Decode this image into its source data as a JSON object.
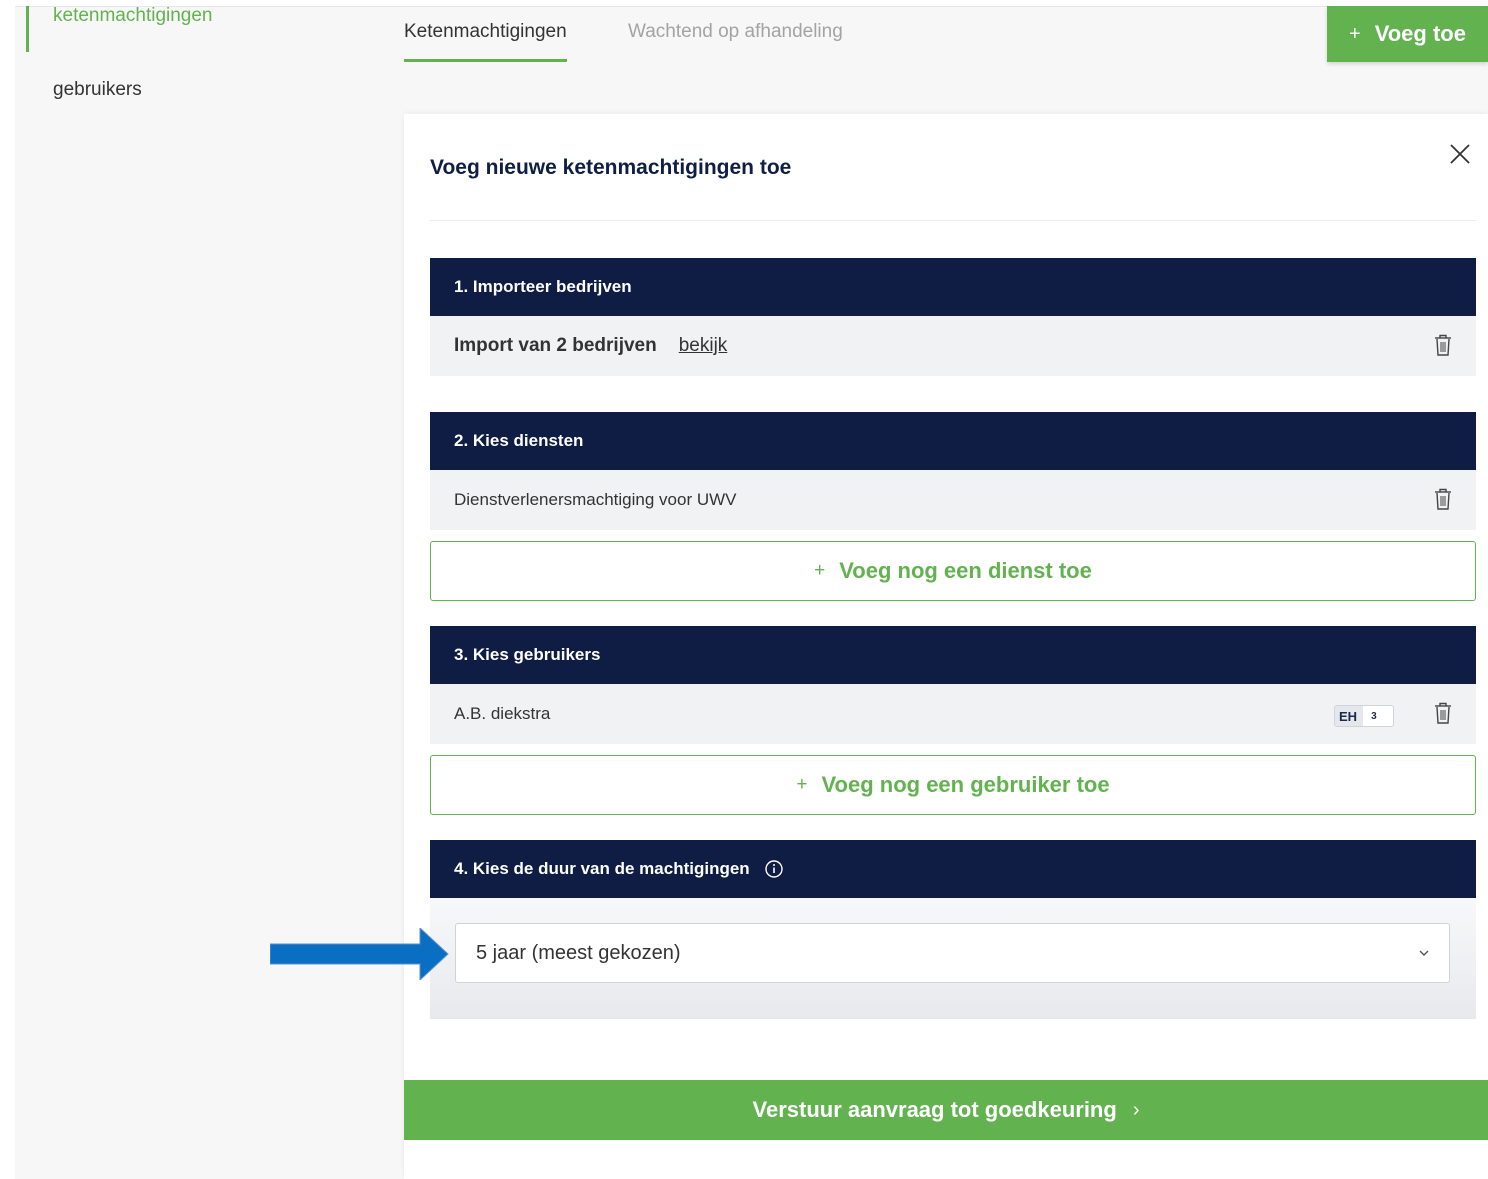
{
  "sidebar": {
    "items": [
      {
        "label": "ketenmachtigingen"
      },
      {
        "label": "gebruikers"
      }
    ]
  },
  "tabs": [
    {
      "label": "Ketenmachtigingen"
    },
    {
      "label": "Wachtend op afhandeling"
    }
  ],
  "header": {
    "add_button": {
      "plus": "+",
      "label": "Voeg toe"
    }
  },
  "modal": {
    "title": "Voeg nieuwe ketenmachtigingen toe",
    "close_icon": "close-icon",
    "sections": [
      {
        "title": "1. Importeer bedrijven",
        "row": {
          "label": "Import van 2 bedrijven",
          "link": "bekijk"
        }
      },
      {
        "title": "2. Kies diensten",
        "row": {
          "label": "Dienstverlenersmachtiging voor UWV"
        },
        "add_button": {
          "plus": "+",
          "label": "Voeg nog een dienst toe"
        }
      },
      {
        "title": "3. Kies gebruikers",
        "row": {
          "label": "A.B. diekstra",
          "badge_left": "EH",
          "badge_right": "3"
        },
        "add_button": {
          "plus": "+",
          "label": "Voeg nog een gebruiker toe"
        }
      },
      {
        "title": "4. Kies de duur van de machtigingen",
        "info_icon": "info-icon",
        "select": {
          "value": "5 jaar (meest gekozen)"
        }
      }
    ],
    "submit": {
      "label": "Verstuur aanvraag tot goedkeuring",
      "chevron": "›"
    }
  },
  "colors": {
    "accent_green": "#62b34f",
    "navy": "#0f1c44",
    "annotation_arrow": "#0a6fc2"
  }
}
